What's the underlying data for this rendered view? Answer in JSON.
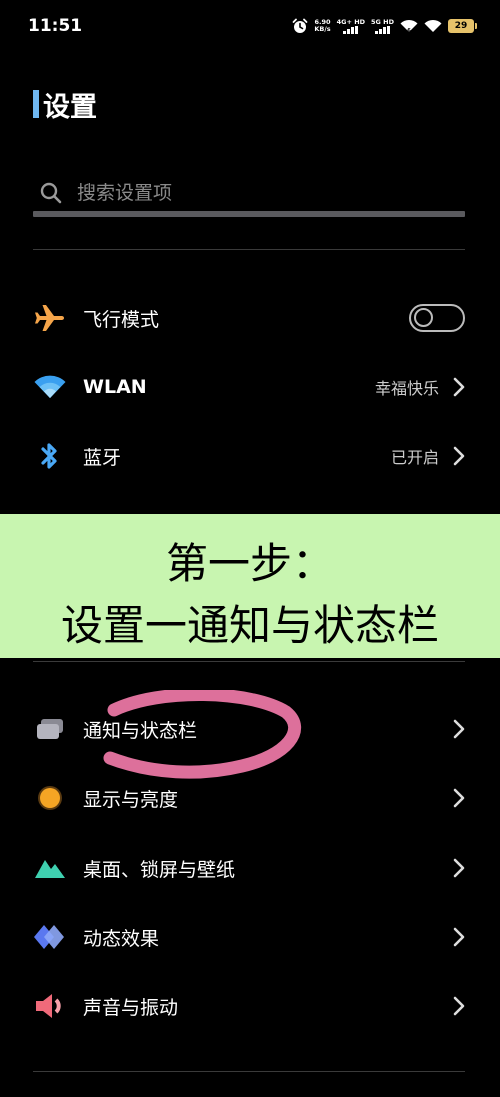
{
  "status_bar": {
    "time": "11:51",
    "net_speed_value": "6.90",
    "net_speed_unit": "KB/s",
    "sim1_label": "4G+ HD",
    "sim2_label": "5G HD",
    "battery": "29"
  },
  "header": {
    "title": "设置"
  },
  "search": {
    "placeholder": "搜索设置项"
  },
  "items_top": [
    {
      "label": "飞行模式",
      "icon": "airplane-icon",
      "control": "toggle",
      "toggle_on": false
    },
    {
      "label": "WLAN",
      "icon": "wifi-icon",
      "value": "幸福快乐"
    },
    {
      "label": "蓝牙",
      "icon": "bluetooth-icon",
      "value": "已开启"
    }
  ],
  "overlay_banner": {
    "line1": "第一步：",
    "line2": "设置一通知与状态栏"
  },
  "items_bottom": [
    {
      "label": "通知与状态栏",
      "icon": "notification-icon"
    },
    {
      "label": "显示与亮度",
      "icon": "brightness-icon"
    },
    {
      "label": "桌面、锁屏与壁纸",
      "icon": "wallpaper-icon"
    },
    {
      "label": "动态效果",
      "icon": "dynamic-effect-icon"
    },
    {
      "label": "声音与振动",
      "icon": "sound-icon"
    }
  ],
  "colors": {
    "background": "#000000",
    "accent": "#6fb8f2",
    "airplane": "#f5a54a",
    "wifi": "#3aa0f0",
    "banner": "#c8f5b0",
    "annotation": "#f07aa8"
  }
}
